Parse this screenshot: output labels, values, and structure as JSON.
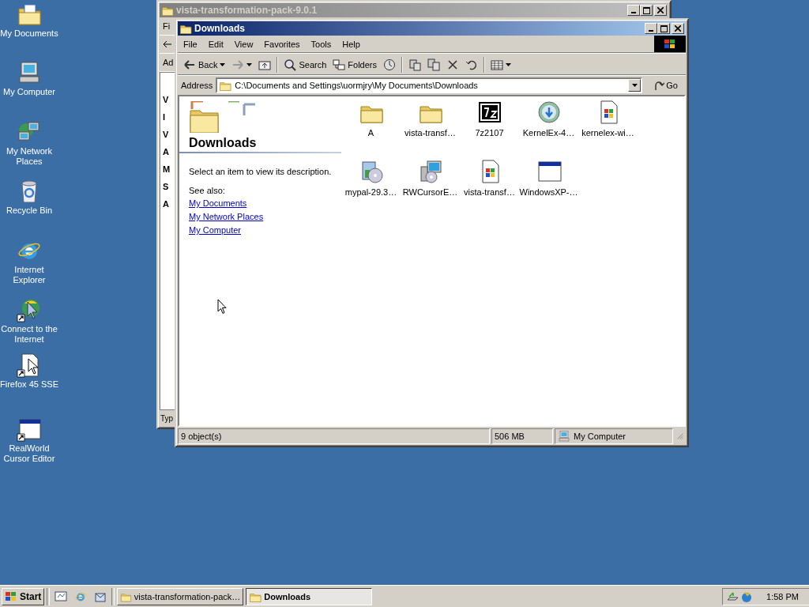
{
  "desktop_icons": [
    {
      "label": "My Documents",
      "kind": "documents"
    },
    {
      "label": "My Computer",
      "kind": "computer"
    },
    {
      "label": "My Network Places",
      "kind": "network"
    },
    {
      "label": "Recycle Bin",
      "kind": "recycle"
    },
    {
      "label": "Internet Explorer",
      "kind": "ie"
    },
    {
      "label": "Connect to the Internet",
      "kind": "connect"
    },
    {
      "label": "Firefox 45 SSE",
      "kind": "shortcut-file"
    },
    {
      "label": "RealWorld Cursor Editor",
      "kind": "shortcut-window"
    }
  ],
  "background_window": {
    "title": "vista-transformation-pack-9.0.1",
    "menu_fragment": "Fi",
    "address_fragment": "Ad",
    "content_fragments": [
      "V",
      "I",
      "V",
      "A",
      "M",
      "S",
      "A"
    ],
    "status_fragment": "Typ"
  },
  "explorer": {
    "title": "Downloads",
    "menu": [
      "File",
      "Edit",
      "View",
      "Favorites",
      "Tools",
      "Help"
    ],
    "toolbar": [
      {
        "kind": "back",
        "label": "Back",
        "disabled": false
      },
      {
        "kind": "forward",
        "disabled": true
      },
      {
        "kind": "up",
        "disabled": false
      },
      {
        "kind": "search",
        "label": "Search",
        "disabled": false
      },
      {
        "kind": "folders",
        "label": "Folders",
        "disabled": false
      },
      {
        "kind": "history",
        "disabled": false
      },
      {
        "kind": "move",
        "disabled": false
      },
      {
        "kind": "copy",
        "disabled": false
      },
      {
        "kind": "delete",
        "disabled": false
      },
      {
        "kind": "undo",
        "disabled": false
      },
      {
        "kind": "views",
        "disabled": false
      }
    ],
    "address": {
      "label": "Address",
      "value": "C:\\Documents and Settings\\uormjry\\My Documents\\Downloads",
      "go": "Go"
    },
    "side_panel": {
      "heading": "Downloads",
      "description": "Select an item to view its description.",
      "see_also": "See also:",
      "links": [
        "My Documents",
        "My Network Places",
        "My Computer"
      ]
    },
    "files": [
      {
        "name": "A",
        "kind": "folder"
      },
      {
        "name": "vista-transf…",
        "kind": "folder"
      },
      {
        "name": "7z2107",
        "kind": "archive"
      },
      {
        "name": "KernelEx-4…",
        "kind": "globe"
      },
      {
        "name": "kernelex-wi…",
        "kind": "winfile"
      },
      {
        "name": "mypal-29.3…",
        "kind": "cd"
      },
      {
        "name": "RWCursorE…",
        "kind": "pc"
      },
      {
        "name": "vista-transf…",
        "kind": "winfile"
      },
      {
        "name": "WindowsXP-…",
        "kind": "window"
      }
    ],
    "status_bar": {
      "objects": "9 object(s)",
      "size": "506 MB",
      "zone": "My Computer"
    }
  },
  "taskbar": {
    "start": "Start",
    "quick_launch": [
      {
        "kind": "desktop"
      },
      {
        "kind": "ie"
      },
      {
        "kind": "outlook"
      }
    ],
    "tasks": [
      {
        "label": "vista-transformation-pack…",
        "selected": false
      },
      {
        "label": "Downloads",
        "selected": true
      }
    ],
    "clock": "1:58 PM"
  }
}
